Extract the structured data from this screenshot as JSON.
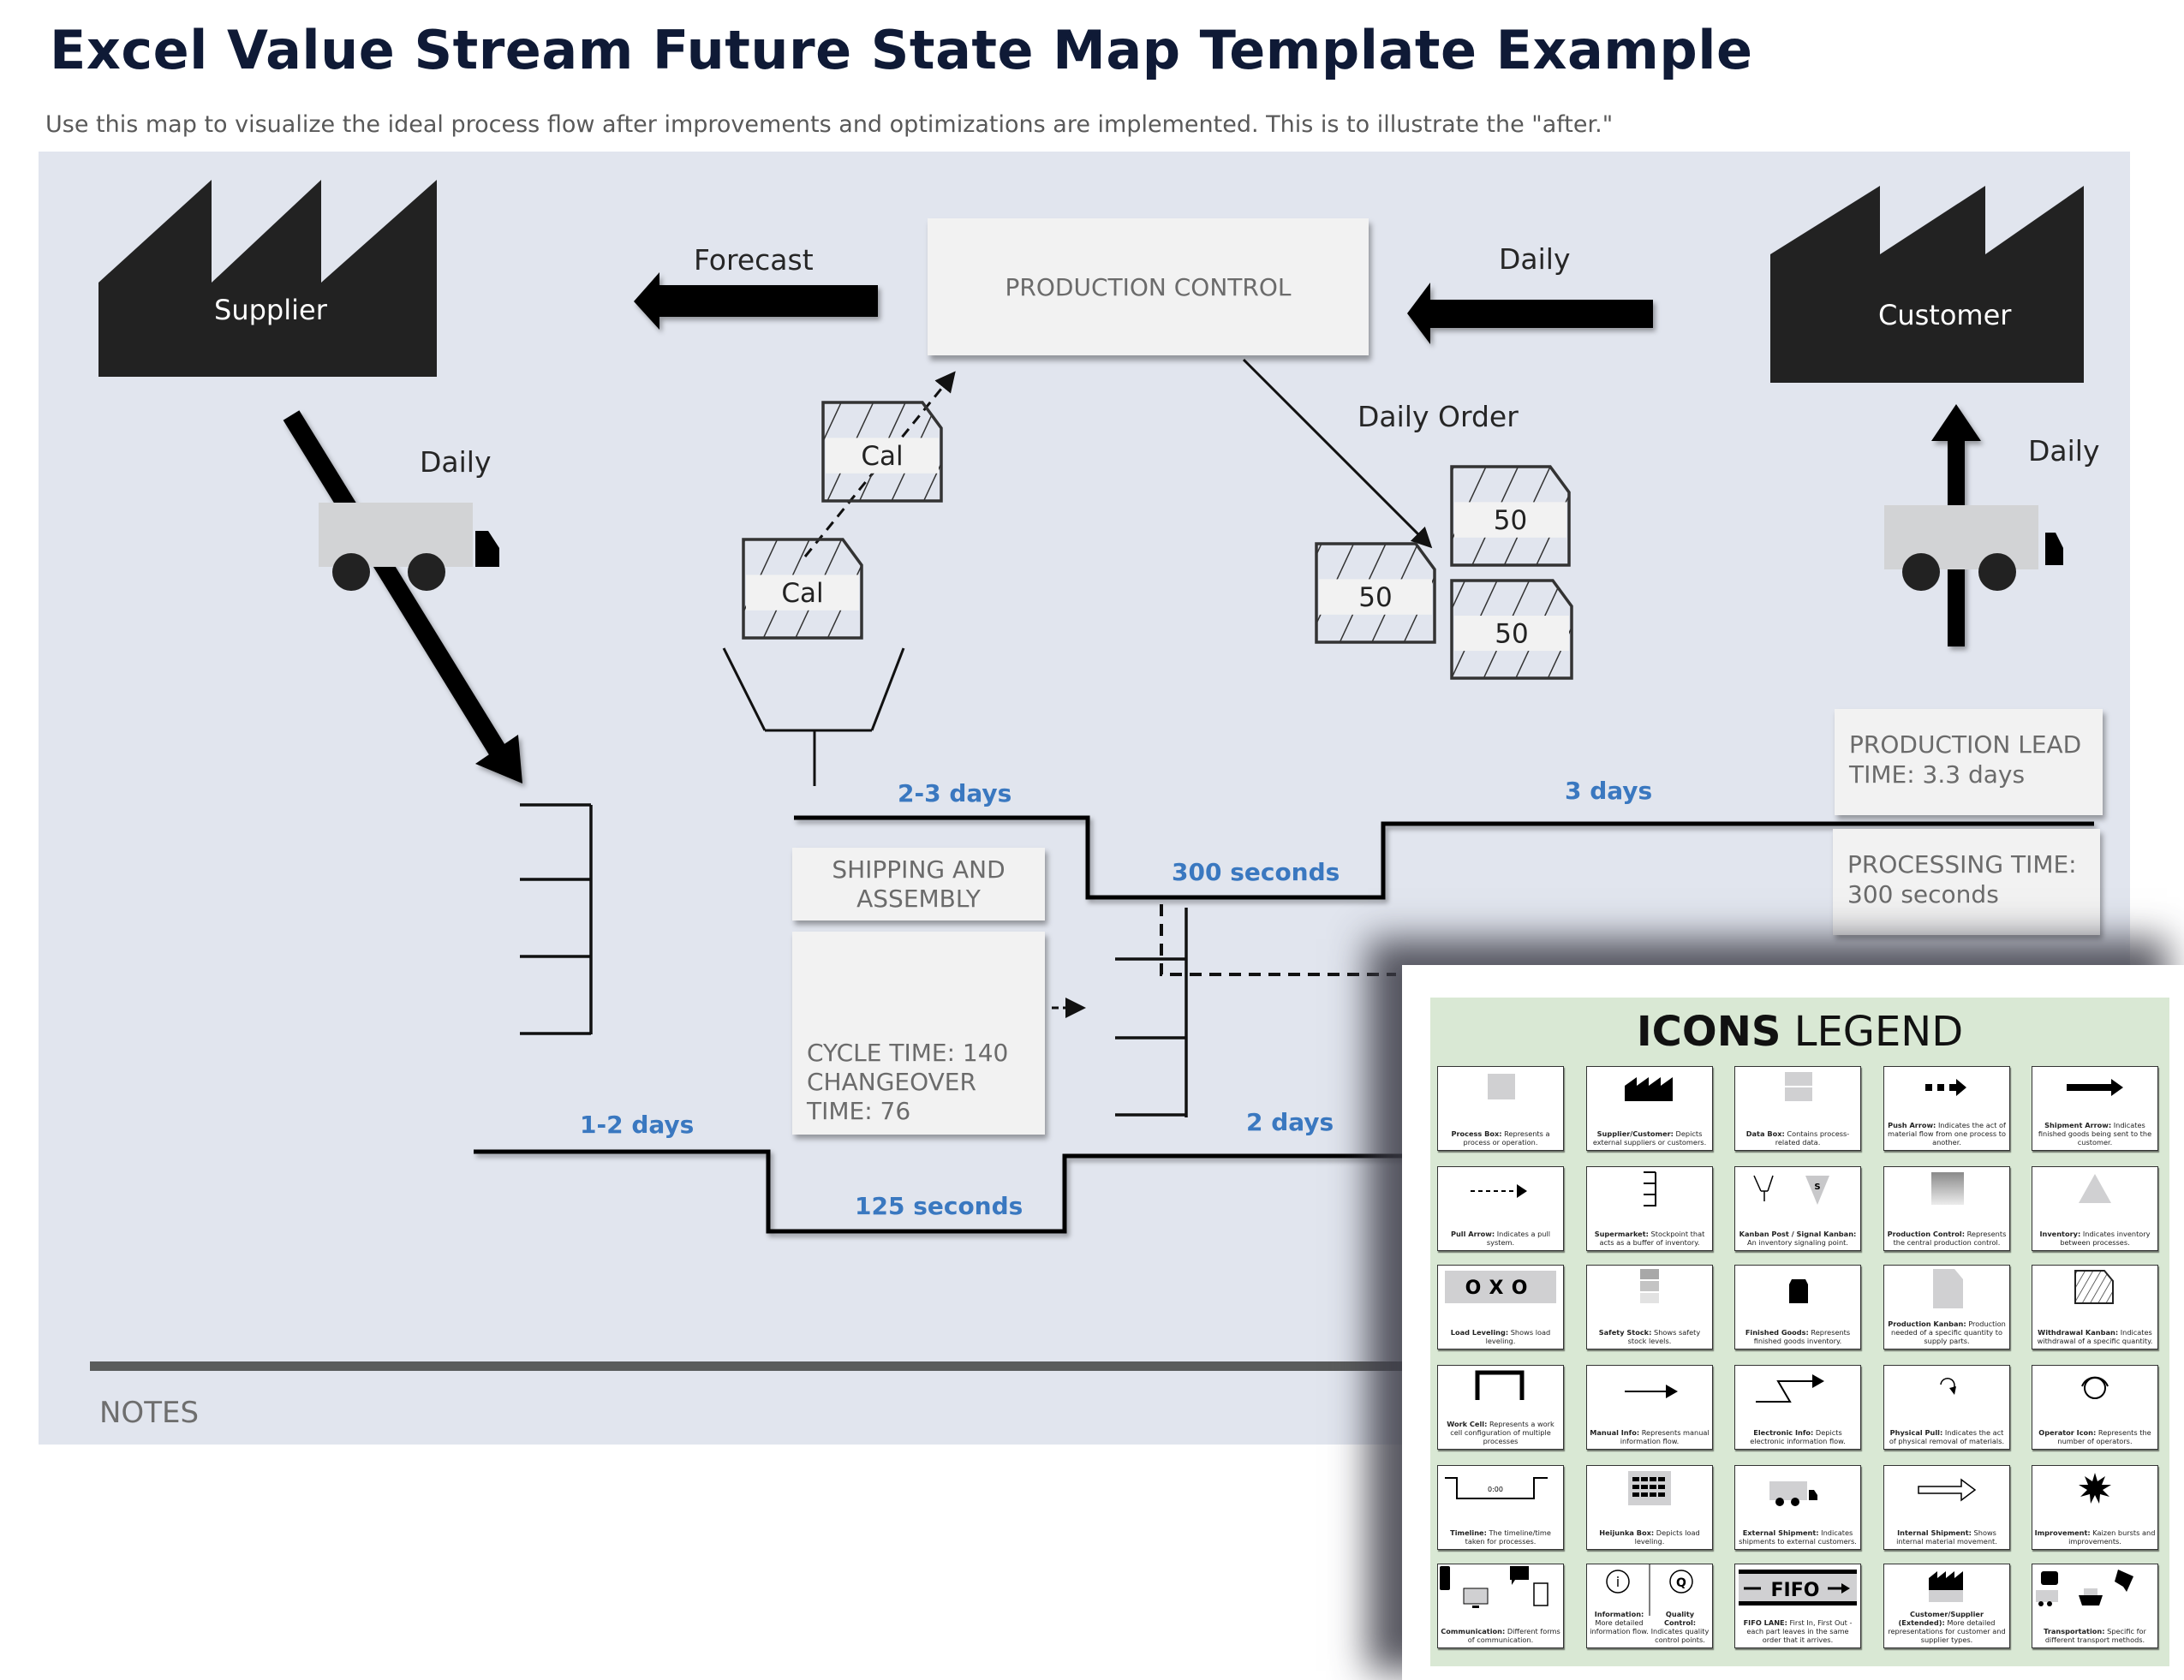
{
  "header": {
    "title": "Excel Value Stream Future State Map Template Example",
    "subtitle": "Use this map to visualize the ideal process flow after improvements and optimizations are implemented. This is to illustrate the \"after.\""
  },
  "map": {
    "supplier_label": "Supplier",
    "customer_label": "Customer",
    "forecast_label": "Forecast",
    "production_control_label": "PRODUCTION CONTROL",
    "customer_to_pc_label": "Daily",
    "supplier_shipment_label": "Daily",
    "customer_shipment_label": "Daily",
    "daily_order_label": "Daily Order",
    "withdrawal_kanbans": [
      "Cal",
      "Cal"
    ],
    "production_kanbans": [
      "50",
      "50",
      "50"
    ],
    "process": {
      "name": "SHIPPING AND ASSEMBLY",
      "data": "CYCLE TIME: 140 CHANGEOVER TIME: 76"
    },
    "timeline": {
      "top": [
        "2-3 days",
        "300 seconds",
        "3 days"
      ],
      "bottom": [
        "1-2 days",
        "125 seconds",
        "2 days"
      ]
    },
    "summary": {
      "lead_time": "PRODUCTION LEAD TIME: 3.3 days",
      "processing_time": "PROCESSING TIME: 300 seconds"
    },
    "notes_label": "NOTES",
    "colors": {
      "background": "#e1e5ee",
      "timeline_label": "#3a78c0",
      "factory": "#222222"
    }
  },
  "legend": {
    "title_bold": "ICONS",
    "title_regular": " LEGEND",
    "items": [
      {
        "name": "Process Box",
        "desc": "Represents a process or operation.",
        "icon": "process-box"
      },
      {
        "name": "Supplier/Customer",
        "desc": "Depicts external suppliers or customers.",
        "icon": "factory"
      },
      {
        "name": "Data Box",
        "desc": "Contains process-related data.",
        "icon": "data-box"
      },
      {
        "name": "Push Arrow",
        "desc": "Indicates the act of material flow from one process to another.",
        "icon": "push-arrow"
      },
      {
        "name": "Shipment Arrow",
        "desc": "Indicates finished goods being sent to the customer.",
        "icon": "shipment-arrow"
      },
      {
        "name": "Pull Arrow",
        "desc": "Indicates a pull system.",
        "icon": "pull-arrow"
      },
      {
        "name": "Supermarket",
        "desc": "Stockpoint that acts as a buffer of inventory.",
        "icon": "supermarket"
      },
      {
        "name": "Kanban Post / Signal Kanban",
        "desc": "An inventory signaling point.",
        "icon": "kanban-post"
      },
      {
        "name": "Production Control",
        "desc": "Represents the central production control.",
        "icon": "production-control"
      },
      {
        "name": "Inventory",
        "desc": "Indicates inventory between processes.",
        "icon": "inventory"
      },
      {
        "name": "Load Leveling",
        "desc": "Shows load leveling.",
        "icon": "load-leveling"
      },
      {
        "name": "Safety Stock",
        "desc": "Shows safety stock levels.",
        "icon": "safety-stock"
      },
      {
        "name": "Finished Goods",
        "desc": "Represents finished goods inventory.",
        "icon": "finished-goods"
      },
      {
        "name": "Production Kanban",
        "desc": "Production needed of a specific quantity to supply parts.",
        "icon": "production-kanban"
      },
      {
        "name": "Withdrawal Kanban",
        "desc": "Indicates withdrawal of a specific quantity.",
        "icon": "withdrawal-kanban"
      },
      {
        "name": "Work Cell",
        "desc": "Represents a work cell configuration of multiple processes",
        "icon": "work-cell"
      },
      {
        "name": "Manual Info",
        "desc": "Represents manual information flow.",
        "icon": "manual-info"
      },
      {
        "name": "Electronic Info",
        "desc": "Depicts electronic information flow.",
        "icon": "electronic-info"
      },
      {
        "name": "Physical Pull",
        "desc": "Indicates the act of physical removal of materials.",
        "icon": "physical-pull"
      },
      {
        "name": "Operator Icon",
        "desc": "Represents the number of operators.",
        "icon": "operator"
      },
      {
        "name": "Timeline",
        "desc": "The timeline/time taken for processes.",
        "icon": "timeline",
        "sample": "0:00"
      },
      {
        "name": "Heijunka Box",
        "desc": "Depicts load leveling.",
        "icon": "heijunka"
      },
      {
        "name": "External Shipment",
        "desc": "Indicates shipments to external customers.",
        "icon": "truck"
      },
      {
        "name": "Internal Shipment",
        "desc": "Shows internal material movement.",
        "icon": "internal-shipment"
      },
      {
        "name": "Improvement",
        "desc": "Kaizen bursts and improvements.",
        "icon": "kaizen-burst"
      },
      {
        "name": "Communication",
        "desc": "Different forms of communication.",
        "icon": "communication"
      },
      {
        "name": "Information",
        "desc": "More detailed information flow.",
        "icon": "information",
        "name2": "Quality Control",
        "desc2": "Indicates quality control points."
      },
      {
        "name": "FIFO LANE",
        "desc": "First In, First Out - each part leaves in the same order that it arrives.",
        "icon": "fifo",
        "sample": "FIFO"
      },
      {
        "name": "Customer/Supplier (Extended)",
        "desc": "More detailed representations for customer and supplier types.",
        "icon": "factory-extended"
      },
      {
        "name": "Transportation",
        "desc": "Specific for different transport methods.",
        "icon": "transportation"
      }
    ]
  }
}
